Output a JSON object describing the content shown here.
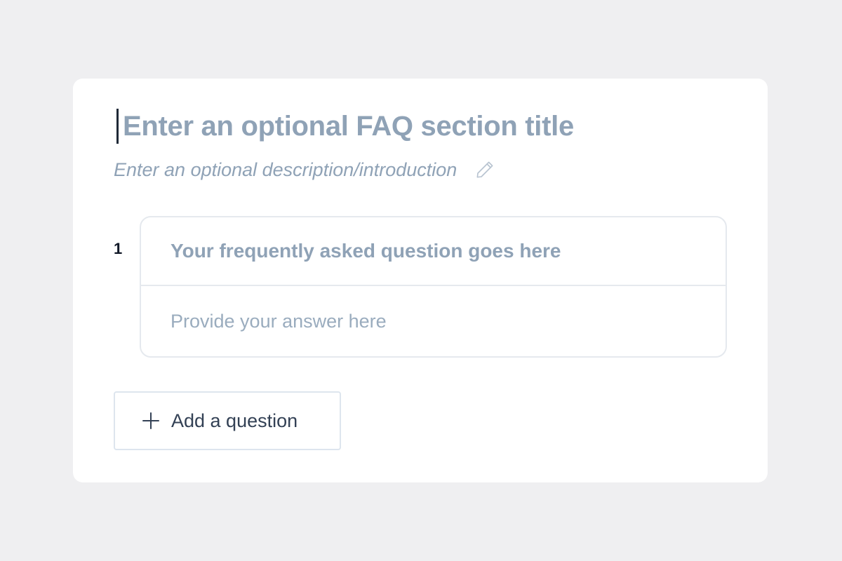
{
  "faq_section": {
    "title_placeholder": "Enter an optional FAQ section title",
    "description_placeholder": "Enter an optional description/introduction",
    "edit_icon": "pencil-icon",
    "items": [
      {
        "number": "1",
        "question_placeholder": "Your frequently asked question goes here",
        "answer_placeholder": "Provide your answer here"
      }
    ],
    "add_button": {
      "icon": "plus-icon",
      "label": "Add a question"
    }
  },
  "colors": {
    "background": "#efeff1",
    "card": "#ffffff",
    "placeholder_text": "#8fa2b6",
    "border": "#e5e9ee",
    "button_text": "#334155"
  }
}
